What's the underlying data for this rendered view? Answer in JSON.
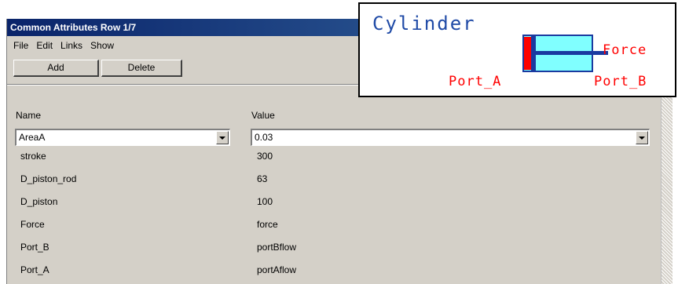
{
  "window": {
    "title": "Common Attributes  Row 1/7"
  },
  "menu": {
    "items": [
      "File",
      "Edit",
      "Links",
      "Show"
    ]
  },
  "toolbar": {
    "add_label": "Add",
    "delete_label": "Delete"
  },
  "table": {
    "name_header": "Name",
    "value_header": "Value",
    "selected_name": "AreaA",
    "selected_value": "0.03",
    "rows": [
      {
        "name": "stroke",
        "value": "300"
      },
      {
        "name": "D_piston_rod",
        "value": "63"
      },
      {
        "name": "D_piston",
        "value": "100"
      },
      {
        "name": "Force",
        "value": "force"
      },
      {
        "name": "Port_B",
        "value": "portBflow"
      },
      {
        "name": "Port_A",
        "value": "portAflow"
      }
    ]
  },
  "symbol": {
    "title": "Cylinder",
    "force_label": "Force",
    "port_a_label": "Port_A",
    "port_b_label": "Port_B"
  },
  "colors": {
    "titlebar": "#0a246a",
    "window_bg": "#d4d0c8",
    "symbol_title": "#1f4aa6",
    "port_labels": "#ff0000",
    "cylinder_body": "#80ffff",
    "piston": "#ff0000",
    "rod": "#1a3aa0"
  }
}
